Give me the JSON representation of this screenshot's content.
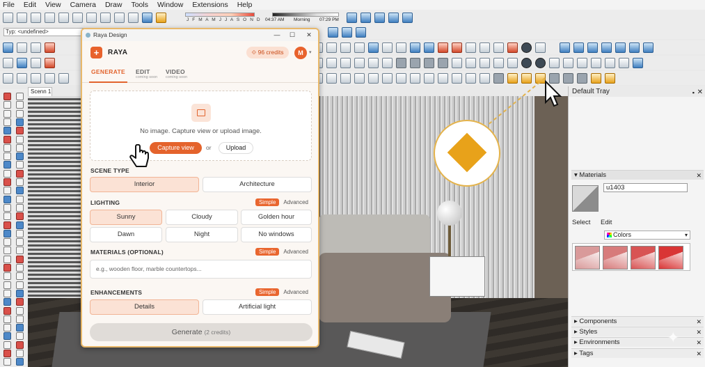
{
  "menu": [
    "File",
    "Edit",
    "View",
    "Camera",
    "Draw",
    "Tools",
    "Window",
    "Extensions",
    "Help"
  ],
  "shadows": {
    "months": "J F M A M J J A S O N D",
    "time_start": "04:37 AM",
    "time_mid": "Morning",
    "time_end": "07:29 PM"
  },
  "type_box": "Typ: <undefined>",
  "scene_tab": "Scenn 1",
  "tray": {
    "title": "Default Tray",
    "materials": {
      "title": "Materials",
      "name": "u1403",
      "tab_select": "Select",
      "tab_edit": "Edit",
      "collection": "Colors",
      "swatch_colors": [
        "#d99a9a",
        "#d77b7b",
        "#d85454",
        "#d93535"
      ]
    },
    "sections": [
      "Components",
      "Styles",
      "Environments",
      "Tags"
    ]
  },
  "panel": {
    "window_title": "Raya Design",
    "app_name": "RAYA",
    "credits": "96 credits",
    "avatar": "M",
    "tabs": [
      {
        "label": "GENERATE",
        "sub": ""
      },
      {
        "label": "EDIT",
        "sub": "coming soon"
      },
      {
        "label": "VIDEO",
        "sub": "coming soon"
      }
    ],
    "dropzone": {
      "message": "No image. Capture view or upload image.",
      "capture": "Capture view",
      "or": "or",
      "upload": "Upload"
    },
    "scene_type": {
      "label": "SCENE TYPE",
      "options": [
        "Interior",
        "Architecture"
      ],
      "selected": "Interior"
    },
    "lighting": {
      "label": "LIGHTING",
      "mode_simple": "Simple",
      "mode_advanced": "Advanced",
      "options": [
        "Sunny",
        "Cloudy",
        "Golden hour",
        "Dawn",
        "Night",
        "No windows"
      ],
      "selected": "Sunny"
    },
    "materials": {
      "label": "MATERIALS (OPTIONAL)",
      "mode_simple": "Simple",
      "mode_advanced": "Advanced",
      "placeholder": "e.g., wooden floor, marble countertops..."
    },
    "enhancements": {
      "label": "ENHANCEMENTS",
      "mode_simple": "Simple",
      "mode_advanced": "Advanced",
      "options": [
        "Details",
        "Artificial light"
      ],
      "selected": "Details"
    },
    "generate": "Generate",
    "generate_cost": "(2 credits)"
  },
  "colors": {
    "accent": "#e4632c",
    "callout": "#e8a21a"
  }
}
